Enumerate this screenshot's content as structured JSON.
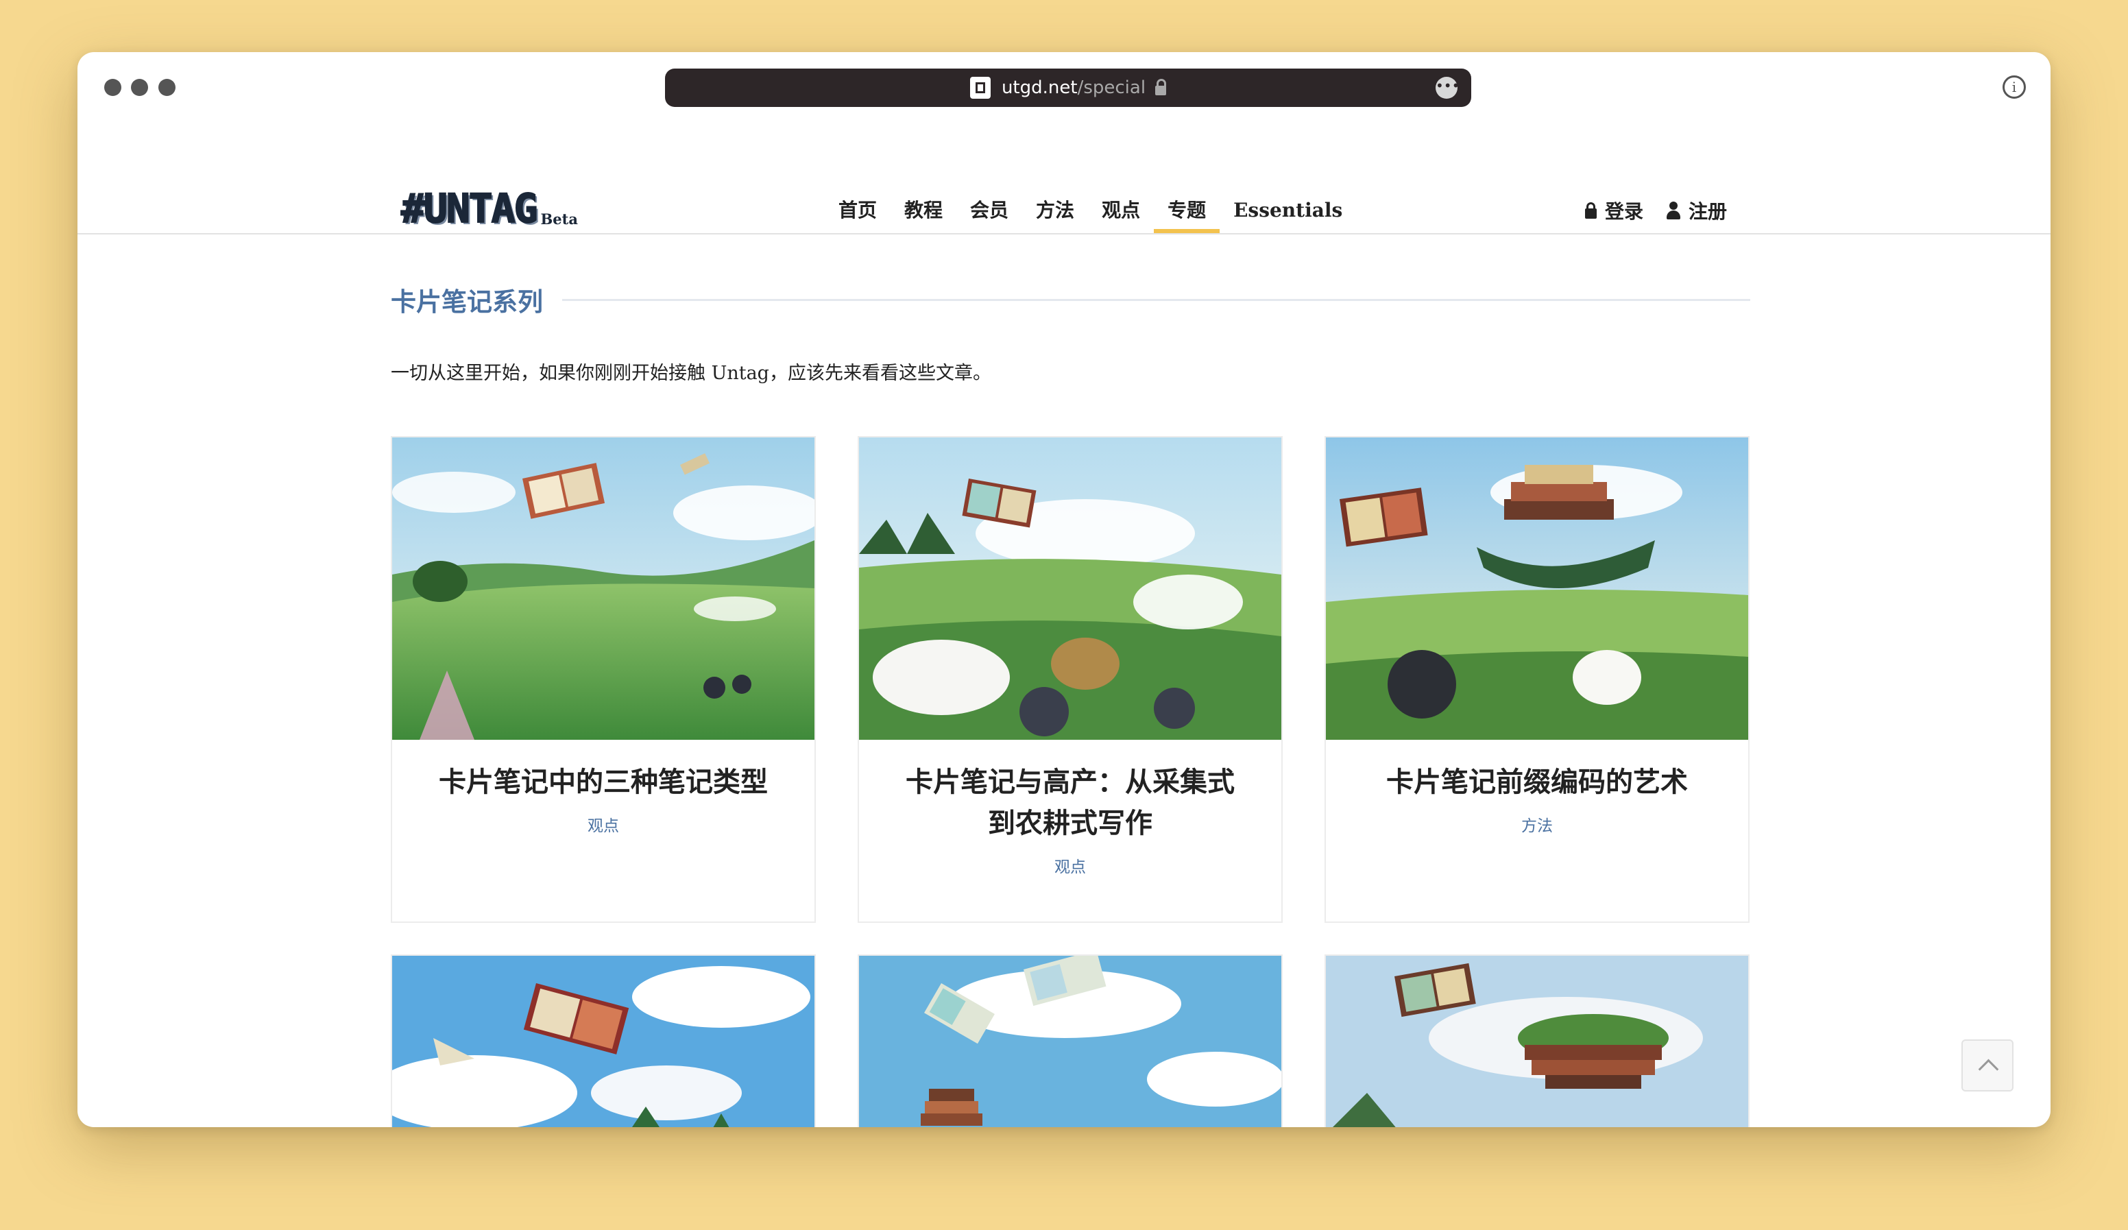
{
  "browser": {
    "url_host": "utgd.net",
    "url_path": "/special"
  },
  "site": {
    "logo_text": "#UNTAG",
    "logo_badge": "Beta"
  },
  "nav": {
    "items": [
      {
        "label": "首页"
      },
      {
        "label": "教程"
      },
      {
        "label": "会员"
      },
      {
        "label": "方法"
      },
      {
        "label": "观点"
      },
      {
        "label": "专题",
        "active": true
      },
      {
        "label": "Essentials"
      }
    ],
    "login_label": "登录",
    "register_label": "注册"
  },
  "section": {
    "title": "卡片笔记系列",
    "intro": "一切从这里开始，如果你刚刚开始接触 Untag，应该先来看看这些文章。"
  },
  "cards": [
    {
      "title": "卡片笔记中的三种笔记类型",
      "tag": "观点",
      "scene": "meadow-books"
    },
    {
      "title": "卡片笔记与高产：从采集式到农耕式写作",
      "tag": "观点",
      "scene": "meadow-books"
    },
    {
      "title": "卡片笔记前缀编码的艺术",
      "tag": "方法",
      "scene": "meadow-books"
    },
    {
      "title": "",
      "tag": "",
      "scene": "sky-books"
    },
    {
      "title": "",
      "tag": "",
      "scene": "sky-books"
    },
    {
      "title": "",
      "tag": "",
      "scene": "sky-books"
    }
  ],
  "colors": {
    "background": "#f6d88f",
    "accent": "#4a71a1",
    "nav_active_underline": "#f3c24e",
    "url_bar": "#2d2628"
  },
  "icons": [
    "page-icon",
    "lock-icon",
    "more-icon",
    "info-icon",
    "user-icon",
    "chevron-up-icon"
  ]
}
